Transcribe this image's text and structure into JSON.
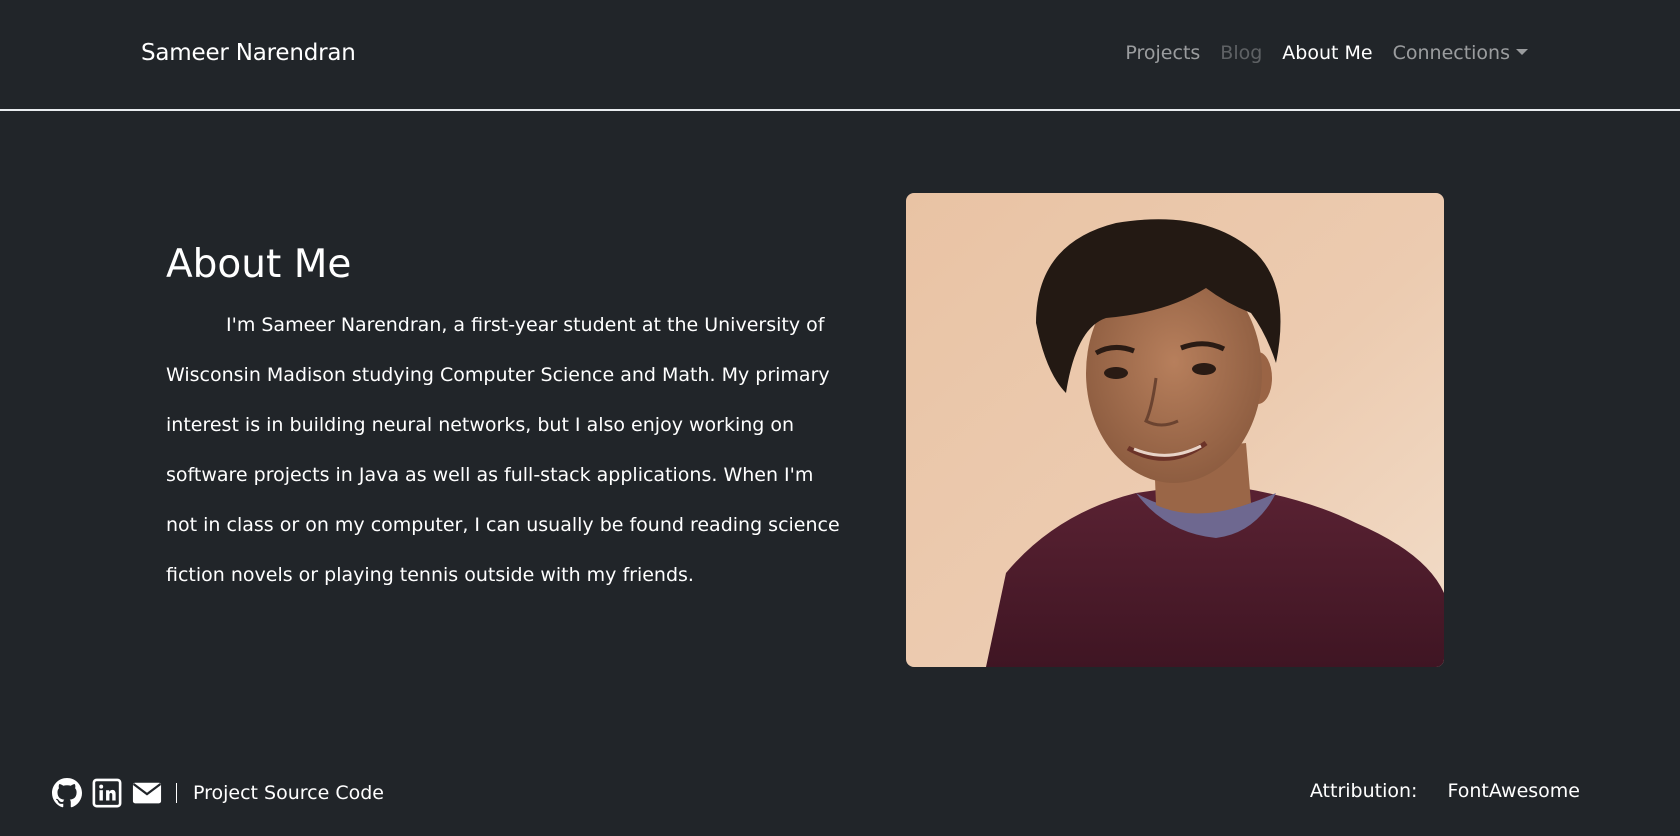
{
  "navbar": {
    "brand": "Sameer Narendran",
    "links": [
      {
        "label": "Projects",
        "state": "normal"
      },
      {
        "label": "Blog",
        "state": "disabled"
      },
      {
        "label": "About Me",
        "state": "active"
      },
      {
        "label": "Connections",
        "state": "dropdown"
      }
    ]
  },
  "about": {
    "heading": "About Me",
    "body": "I'm Sameer Narendran, a first-year student at the University of Wisconsin Madison studying Computer Science and Math. My primary interest is in building neural networks, but I also enjoy working on software projects in Java as well as full-stack applications. When I'm not in class or on my computer, I can usually be found reading science fiction novels or playing tennis outside with my friends."
  },
  "footer": {
    "icons": [
      "github-icon",
      "linkedin-icon",
      "envelope-icon"
    ],
    "source_link": "Project Source Code",
    "attribution_label": "Attribution:",
    "attribution_link": "FontAwesome"
  },
  "colors": {
    "background": "#212529",
    "divider": "#e9ecef",
    "nav_muted": "rgba(255,255,255,0.55)",
    "nav_active": "#ffffff"
  }
}
